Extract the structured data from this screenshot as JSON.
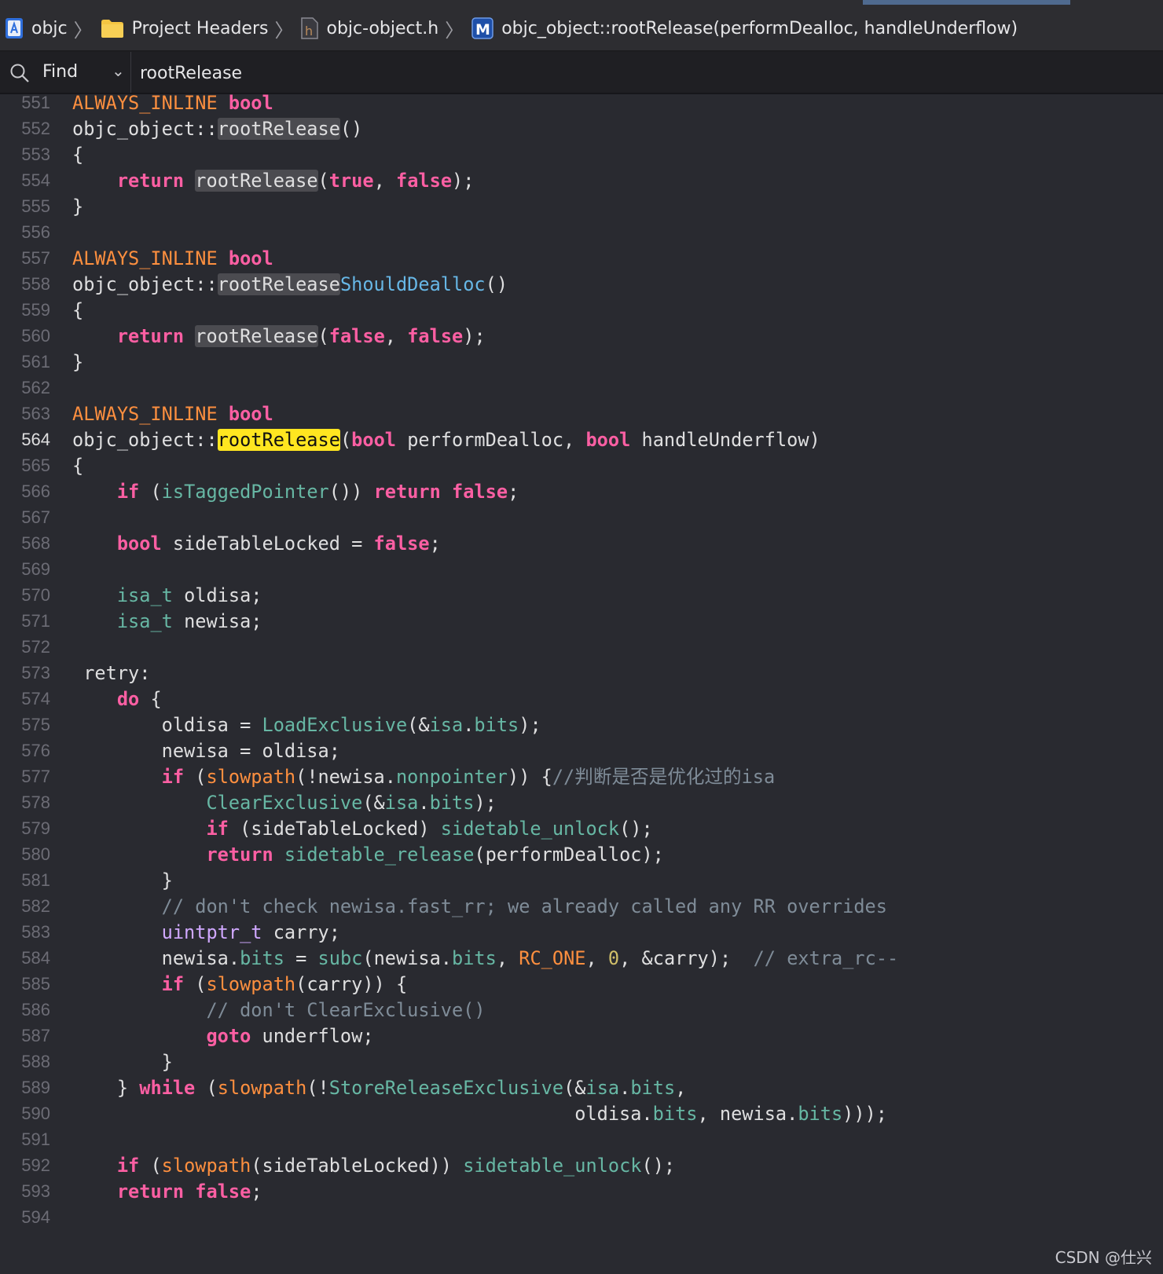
{
  "breadcrumb": {
    "project": "objc",
    "group": "Project Headers",
    "file": "objc-object.h",
    "symbol": "objc_object::rootRelease(performDealloc, handleUnderflow)",
    "file_icon_glyph": "h",
    "symbol_icon_glyph": "M"
  },
  "find": {
    "mode": "Find",
    "query": "rootRelease"
  },
  "editor": {
    "current_line": "564",
    "line_numbers": [
      "551",
      "552",
      "553",
      "554",
      "555",
      "556",
      "557",
      "558",
      "559",
      "560",
      "561",
      "562",
      "563",
      "564",
      "565",
      "566",
      "567",
      "568",
      "569",
      "570",
      "571",
      "572",
      "573",
      "574",
      "575",
      "576",
      "577",
      "578",
      "579",
      "580",
      "581",
      "582",
      "583",
      "584",
      "585",
      "586",
      "587",
      "588",
      "589",
      "590",
      "591",
      "592",
      "593",
      "594"
    ],
    "code_lines": [
      [
        {
          "t": "ALWAYS_INLINE",
          "c": "mac"
        },
        {
          "t": " "
        },
        {
          "t": "bool",
          "c": "kw"
        }
      ],
      [
        {
          "t": "objc_object::"
        },
        {
          "t": "rootRelease",
          "c": "hl"
        },
        {
          "t": "()"
        }
      ],
      [
        {
          "t": "{"
        }
      ],
      [
        {
          "t": "    "
        },
        {
          "t": "return",
          "c": "kw"
        },
        {
          "t": " "
        },
        {
          "t": "rootRelease",
          "c": "hl"
        },
        {
          "t": "("
        },
        {
          "t": "true",
          "c": "kw"
        },
        {
          "t": ", "
        },
        {
          "t": "false",
          "c": "kw"
        },
        {
          "t": ");"
        }
      ],
      [
        {
          "t": "}"
        }
      ],
      [],
      [
        {
          "t": "ALWAYS_INLINE",
          "c": "mac"
        },
        {
          "t": " "
        },
        {
          "t": "bool",
          "c": "kw"
        }
      ],
      [
        {
          "t": "objc_object::"
        },
        {
          "t": "rootRelease",
          "c": "hl"
        },
        {
          "t": "ShouldDealloc",
          "c": "hlblue"
        },
        {
          "t": "()"
        }
      ],
      [
        {
          "t": "{"
        }
      ],
      [
        {
          "t": "    "
        },
        {
          "t": "return",
          "c": "kw"
        },
        {
          "t": " "
        },
        {
          "t": "rootRelease",
          "c": "hl"
        },
        {
          "t": "("
        },
        {
          "t": "false",
          "c": "kw"
        },
        {
          "t": ", "
        },
        {
          "t": "false",
          "c": "kw"
        },
        {
          "t": ");"
        }
      ],
      [
        {
          "t": "}"
        }
      ],
      [],
      [
        {
          "t": "ALWAYS_INLINE",
          "c": "mac"
        },
        {
          "t": " "
        },
        {
          "t": "bool",
          "c": "kw"
        }
      ],
      [
        {
          "t": "objc_object::"
        },
        {
          "t": "rootRelease",
          "c": "hlcur"
        },
        {
          "t": "("
        },
        {
          "t": "bool",
          "c": "kw"
        },
        {
          "t": " performDealloc, "
        },
        {
          "t": "bool",
          "c": "kw"
        },
        {
          "t": " handleUnderflow)"
        }
      ],
      [
        {
          "t": "{"
        }
      ],
      [
        {
          "t": "    "
        },
        {
          "t": "if",
          "c": "kw"
        },
        {
          "t": " ("
        },
        {
          "t": "isTaggedPointer",
          "c": "fn"
        },
        {
          "t": "()) "
        },
        {
          "t": "return",
          "c": "kw"
        },
        {
          "t": " "
        },
        {
          "t": "false",
          "c": "kw"
        },
        {
          "t": ";"
        }
      ],
      [],
      [
        {
          "t": "    "
        },
        {
          "t": "bool",
          "c": "kw"
        },
        {
          "t": " sideTableLocked = "
        },
        {
          "t": "false",
          "c": "kw"
        },
        {
          "t": ";"
        }
      ],
      [],
      [
        {
          "t": "    "
        },
        {
          "t": "isa_t",
          "c": "fn"
        },
        {
          "t": " oldisa;"
        }
      ],
      [
        {
          "t": "    "
        },
        {
          "t": "isa_t",
          "c": "fn"
        },
        {
          "t": " newisa;"
        }
      ],
      [],
      [
        {
          "t": " retry:"
        }
      ],
      [
        {
          "t": "    "
        },
        {
          "t": "do",
          "c": "kw"
        },
        {
          "t": " {"
        }
      ],
      [
        {
          "t": "        oldisa = "
        },
        {
          "t": "LoadExclusive",
          "c": "fn"
        },
        {
          "t": "(&"
        },
        {
          "t": "isa",
          "c": "fn"
        },
        {
          "t": "."
        },
        {
          "t": "bits",
          "c": "fn"
        },
        {
          "t": ");"
        }
      ],
      [
        {
          "t": "        newisa = oldisa;"
        }
      ],
      [
        {
          "t": "        "
        },
        {
          "t": "if",
          "c": "kw"
        },
        {
          "t": " ("
        },
        {
          "t": "slowpath",
          "c": "mac"
        },
        {
          "t": "(!newisa."
        },
        {
          "t": "nonpointer",
          "c": "fn"
        },
        {
          "t": ")) {"
        },
        {
          "t": "//判断是否是优化过的isa",
          "c": "cmt"
        }
      ],
      [
        {
          "t": "            "
        },
        {
          "t": "ClearExclusive",
          "c": "fn"
        },
        {
          "t": "(&"
        },
        {
          "t": "isa",
          "c": "fn"
        },
        {
          "t": "."
        },
        {
          "t": "bits",
          "c": "fn"
        },
        {
          "t": ");"
        }
      ],
      [
        {
          "t": "            "
        },
        {
          "t": "if",
          "c": "kw"
        },
        {
          "t": " (sideTableLocked) "
        },
        {
          "t": "sidetable_unlock",
          "c": "fn"
        },
        {
          "t": "();"
        }
      ],
      [
        {
          "t": "            "
        },
        {
          "t": "return",
          "c": "kw"
        },
        {
          "t": " "
        },
        {
          "t": "sidetable_release",
          "c": "fn"
        },
        {
          "t": "(performDealloc);"
        }
      ],
      [
        {
          "t": "        }"
        }
      ],
      [
        {
          "t": "        "
        },
        {
          "t": "// don't check newisa.fast_rr; we already called any RR overrides",
          "c": "cmt"
        }
      ],
      [
        {
          "t": "        "
        },
        {
          "t": "uintptr_t",
          "c": "ty"
        },
        {
          "t": " carry;"
        }
      ],
      [
        {
          "t": "        newisa."
        },
        {
          "t": "bits",
          "c": "fn"
        },
        {
          "t": " = "
        },
        {
          "t": "subc",
          "c": "fn"
        },
        {
          "t": "(newisa."
        },
        {
          "t": "bits",
          "c": "fn"
        },
        {
          "t": ", "
        },
        {
          "t": "RC_ONE",
          "c": "mac"
        },
        {
          "t": ", "
        },
        {
          "t": "0",
          "c": "num"
        },
        {
          "t": ", &carry);  "
        },
        {
          "t": "// extra_rc--",
          "c": "cmt"
        }
      ],
      [
        {
          "t": "        "
        },
        {
          "t": "if",
          "c": "kw"
        },
        {
          "t": " ("
        },
        {
          "t": "slowpath",
          "c": "mac"
        },
        {
          "t": "(carry)) {"
        }
      ],
      [
        {
          "t": "            "
        },
        {
          "t": "// don't ClearExclusive()",
          "c": "cmt"
        }
      ],
      [
        {
          "t": "            "
        },
        {
          "t": "goto",
          "c": "kw"
        },
        {
          "t": " underflow;"
        }
      ],
      [
        {
          "t": "        }"
        }
      ],
      [
        {
          "t": "    } "
        },
        {
          "t": "while",
          "c": "kw"
        },
        {
          "t": " ("
        },
        {
          "t": "slowpath",
          "c": "mac"
        },
        {
          "t": "(!"
        },
        {
          "t": "StoreReleaseExclusive",
          "c": "fn"
        },
        {
          "t": "(&"
        },
        {
          "t": "isa",
          "c": "fn"
        },
        {
          "t": "."
        },
        {
          "t": "bits",
          "c": "fn"
        },
        {
          "t": ","
        }
      ],
      [
        {
          "t": "                                             oldisa."
        },
        {
          "t": "bits",
          "c": "fn"
        },
        {
          "t": ", newisa."
        },
        {
          "t": "bits",
          "c": "fn"
        },
        {
          "t": ")));"
        }
      ],
      [],
      [
        {
          "t": "    "
        },
        {
          "t": "if",
          "c": "kw"
        },
        {
          "t": " ("
        },
        {
          "t": "slowpath",
          "c": "mac"
        },
        {
          "t": "(sideTableLocked)) "
        },
        {
          "t": "sidetable_unlock",
          "c": "fn"
        },
        {
          "t": "();"
        }
      ],
      [
        {
          "t": "    "
        },
        {
          "t": "return",
          "c": "kw"
        },
        {
          "t": " "
        },
        {
          "t": "false",
          "c": "kw"
        },
        {
          "t": ";"
        }
      ],
      []
    ]
  },
  "watermark": "CSDN @仕兴"
}
